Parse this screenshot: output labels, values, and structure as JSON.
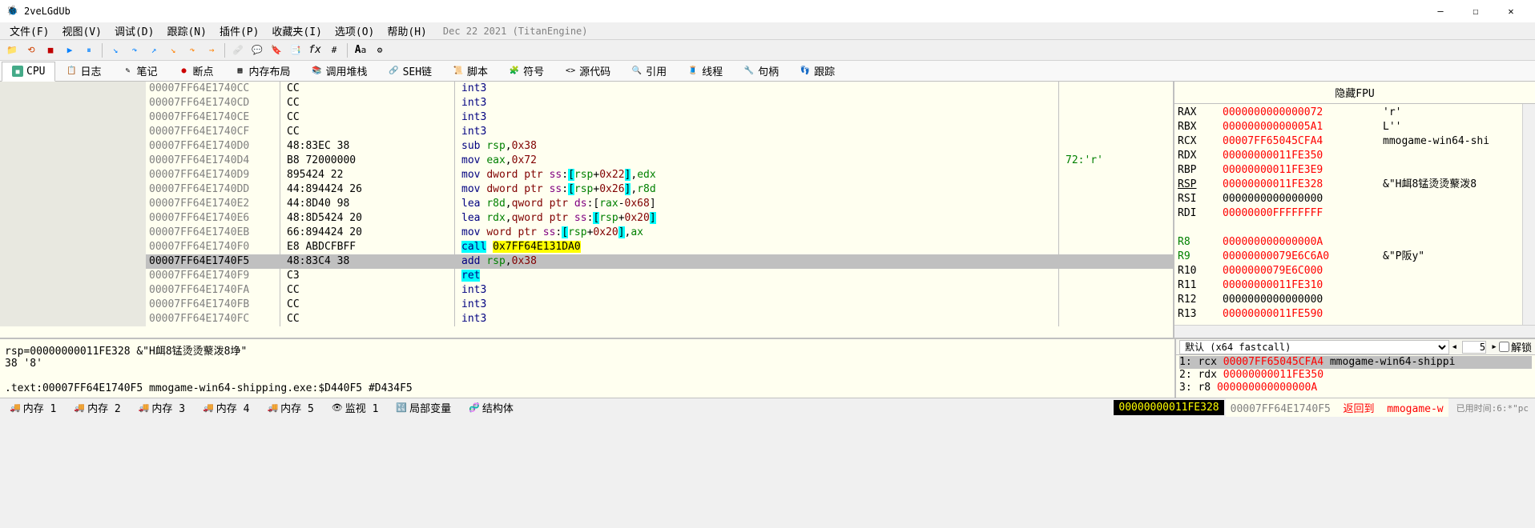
{
  "title": "2veLGdUb",
  "build": "Dec 22 2021 (TitanEngine)",
  "menus": {
    "file": "文件(F)",
    "view": "视图(V)",
    "debug": "调试(D)",
    "trace": "跟踪(N)",
    "plugins": "插件(P)",
    "favorites": "收藏夹(I)",
    "options": "选项(O)",
    "help": "帮助(H)"
  },
  "tabs": {
    "cpu": "CPU",
    "log": "日志",
    "notes": "笔记",
    "breakpoints": "断点",
    "memmap": "内存布局",
    "callstack": "调用堆栈",
    "seh": "SEH链",
    "script": "脚本",
    "symbols": "符号",
    "source": "源代码",
    "refs": "引用",
    "threads": "线程",
    "handles": "句柄",
    "follow": "跟踪"
  },
  "disasm": [
    {
      "addr": "00007FF64E1740CC",
      "bytes": "CC",
      "op": "int3"
    },
    {
      "addr": "00007FF64E1740CD",
      "bytes": "CC",
      "op": "int3"
    },
    {
      "addr": "00007FF64E1740CE",
      "bytes": "CC",
      "op": "int3"
    },
    {
      "addr": "00007FF64E1740CF",
      "bytes": "CC",
      "op": "int3"
    },
    {
      "addr": "00007FF64E1740D0",
      "bytes": "48:83EC 38",
      "op": "sub rsp,0x38"
    },
    {
      "addr": "00007FF64E1740D4",
      "bytes": "B8 72000000",
      "op": "mov eax,0x72",
      "cmt": "72:'r'"
    },
    {
      "addr": "00007FF64E1740D9",
      "bytes": "895424 22",
      "op": "mov dword ptr ss:[rsp+0x22],edx"
    },
    {
      "addr": "00007FF64E1740DD",
      "bytes": "44:894424 26",
      "op": "mov dword ptr ss:[rsp+0x26],r8d"
    },
    {
      "addr": "00007FF64E1740E2",
      "bytes": "44:8D40 98",
      "op": "lea r8d,qword ptr ds:[rax-0x68]"
    },
    {
      "addr": "00007FF64E1740E6",
      "bytes": "48:8D5424 20",
      "op": "lea rdx,qword ptr ss:[rsp+0x20]"
    },
    {
      "addr": "00007FF64E1740EB",
      "bytes": "66:894424 20",
      "op": "mov word ptr ss:[rsp+0x20],ax"
    },
    {
      "addr": "00007FF64E1740F0",
      "bytes": "E8 ABDCFBFF",
      "op": "call 0x7FF64E131DA0"
    },
    {
      "addr": "00007FF64E1740F5",
      "bytes": "48:83C4 38",
      "op": "add rsp,0x38",
      "sel": true
    },
    {
      "addr": "00007FF64E1740F9",
      "bytes": "C3",
      "op": "ret"
    },
    {
      "addr": "00007FF64E1740FA",
      "bytes": "CC",
      "op": "int3"
    },
    {
      "addr": "00007FF64E1740FB",
      "bytes": "CC",
      "op": "int3"
    },
    {
      "addr": "00007FF64E1740FC",
      "bytes": "CC",
      "op": "int3"
    }
  ],
  "reg_header": "隐藏FPU",
  "registers": [
    {
      "name": "RAX",
      "val": "0000000000000072",
      "cmt": "'r'"
    },
    {
      "name": "RBX",
      "val": "00000000000005A1",
      "cmt": "L''"
    },
    {
      "name": "RCX",
      "val": "00007FF65045CFA4",
      "cmt": "mmogame-win64-shi"
    },
    {
      "name": "RDX",
      "val": "00000000011FE350"
    },
    {
      "name": "RBP",
      "val": "00000000011FE3E9"
    },
    {
      "name": "RSP",
      "val": "00000000011FE328",
      "ul": true,
      "cmt": "&\"H衈8锰烫烫藂泼8"
    },
    {
      "name": "RSI",
      "val": "0000000000000000",
      "black": true
    },
    {
      "name": "RDI",
      "val": "00000000FFFFFFFF"
    },
    {
      "name": "",
      "val": ""
    },
    {
      "name": "R8",
      "val": "000000000000000A",
      "grn": true
    },
    {
      "name": "R9",
      "val": "00000000079E6C6A0",
      "grn": true,
      "cmt": "&\"P阪y\""
    },
    {
      "name": "R10",
      "val": "0000000079E6C000"
    },
    {
      "name": "R11",
      "val": "00000000011FE310"
    },
    {
      "name": "R12",
      "val": "0000000000000000",
      "black": true
    },
    {
      "name": "R13",
      "val": "00000000011FE590"
    }
  ],
  "info": {
    "l1": "rsp=00000000011FE328 &\"H衈8锰烫烫藂泼8埩\"",
    "l2": "38 '8'",
    "l3": ".text:00007FF64E1740F5 mmogame-win64-shipping.exe:$D440F5 #D434F5"
  },
  "args": {
    "convention": "默认 (x64 fastcall)",
    "count": "5",
    "lock": "解锁",
    "rows": [
      {
        "n": "1:",
        "r": "rcx",
        "v": "00007FF65045CFA4",
        "c": "mmogame-win64-shippi"
      },
      {
        "n": "2:",
        "r": "rdx",
        "v": "00000000011FE350"
      },
      {
        "n": "3:",
        "r": "r8",
        "v": "000000000000000A"
      }
    ]
  },
  "btabs": {
    "m1": "内存 1",
    "m2": "内存 2",
    "m3": "内存 3",
    "m4": "内存 4",
    "m5": "内存 5",
    "watch": "监视 1",
    "locals": "局部变量",
    "struct": "结构体"
  },
  "status": {
    "addr": "00000000011FE328",
    "rip": "00007FF64E1740F5",
    "ret": "返回到",
    "mod": "mmogame-w",
    "right": "已用时间:6:*\"pc"
  }
}
